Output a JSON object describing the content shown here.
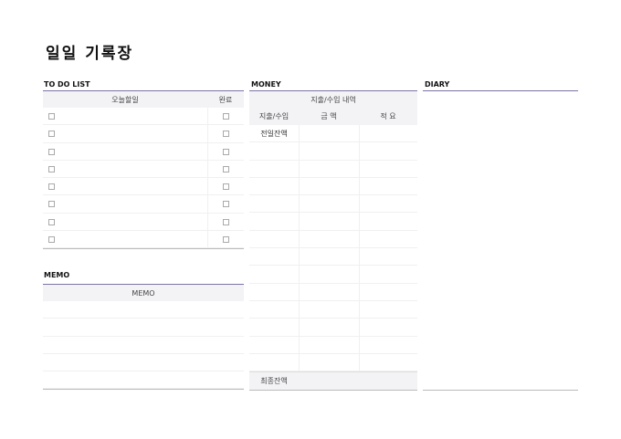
{
  "title": "일일 기록장",
  "todo": {
    "heading": "TO DO LIST",
    "col_task": "오늘할일",
    "col_done": "완료",
    "row_count": 8
  },
  "memo": {
    "heading": "MEMO",
    "col": "MEMO",
    "row_count": 5
  },
  "money": {
    "heading": "MONEY",
    "group_header": "지출/수입 내역",
    "cols": [
      "지출/수입",
      "금 액",
      "적 요"
    ],
    "first_row": "전일잔액",
    "last_row": "최종잔액",
    "row_count": 14
  },
  "diary": {
    "heading": "DIARY"
  }
}
